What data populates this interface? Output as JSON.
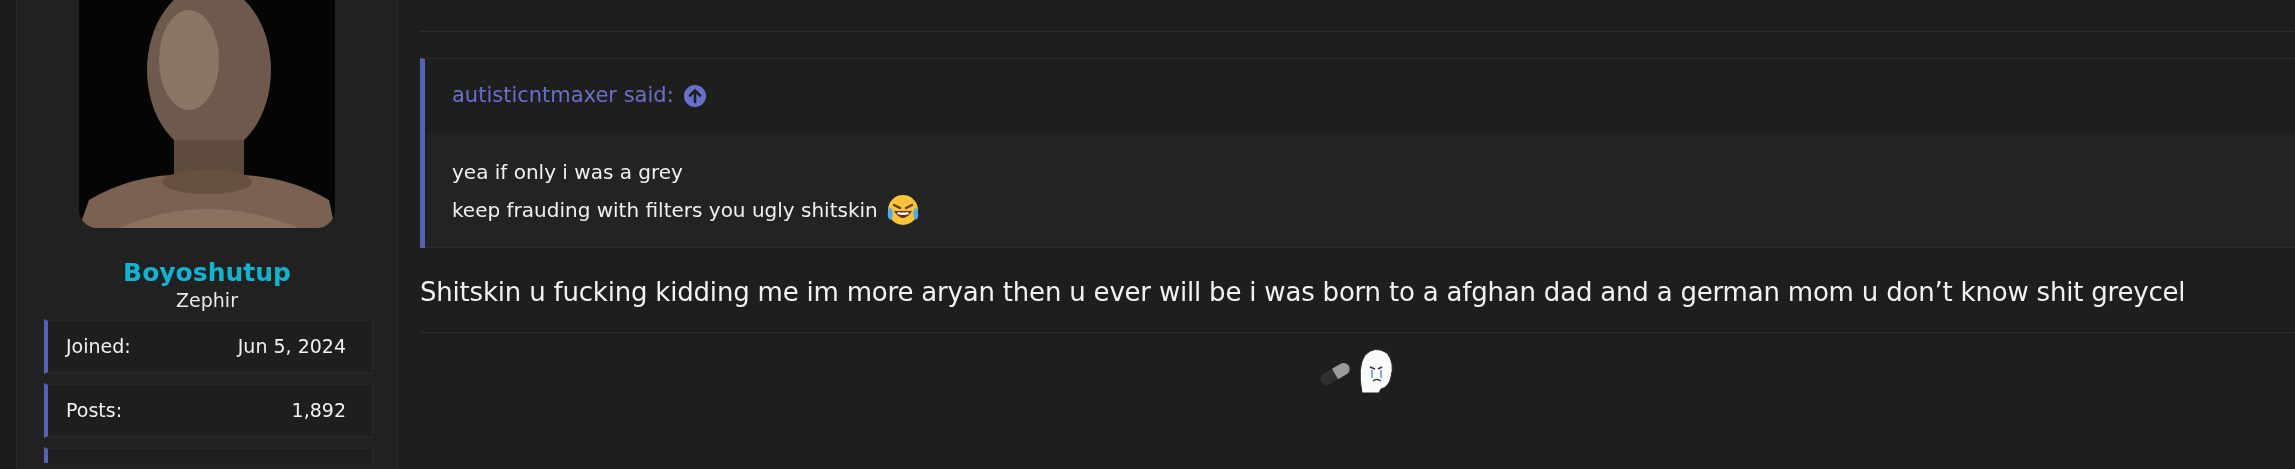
{
  "user": {
    "username": "Boyoshutup",
    "title": "Zephir",
    "stats": [
      {
        "label": "Joined:",
        "value": "Jun 5, 2024"
      },
      {
        "label": "Posts:",
        "value": "1,892"
      }
    ],
    "stats_cut_off": true
  },
  "post": {
    "quote": {
      "author": "autisticntmaxer said:",
      "lines": [
        {
          "text": "yea if only i was a grey",
          "emoji": false
        },
        {
          "text": "keep frauding with filters you ugly shitskin",
          "emoji": true
        }
      ]
    },
    "body": "Shitskin u fucking kidding me im more aryan then u ever will be i was born to a afghan dad and a german mom u don’t know shit greycel"
  }
}
